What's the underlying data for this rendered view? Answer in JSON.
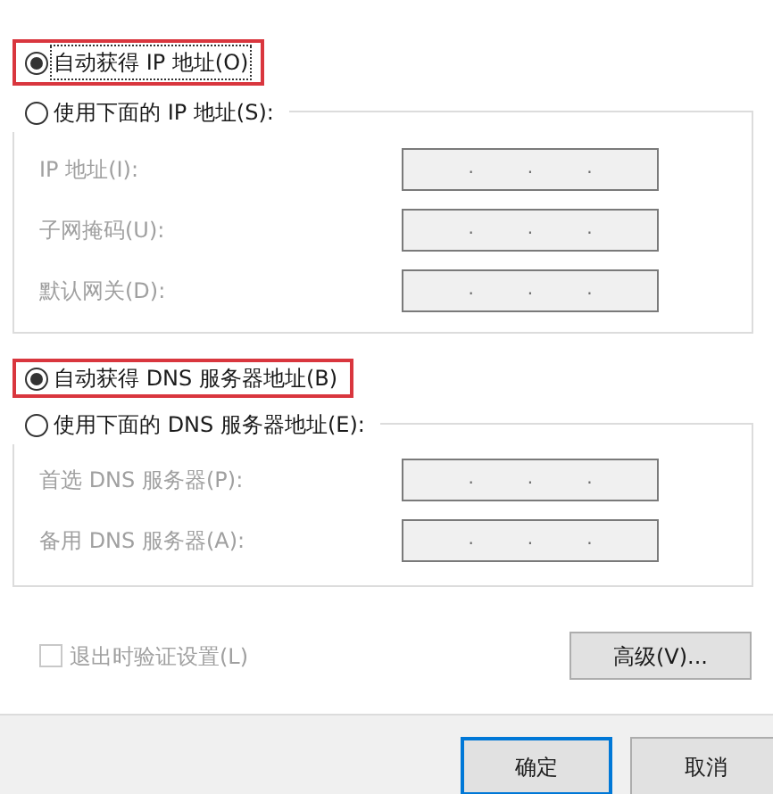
{
  "ip_section": {
    "options": [
      {
        "label": "自动获得 IP 地址(O)",
        "selected": true,
        "highlighted": true,
        "focused": true
      },
      {
        "label": "使用下面的 IP 地址(S):",
        "selected": false,
        "highlighted": false,
        "focused": false
      }
    ],
    "fields": [
      {
        "label": "IP 地址(I):",
        "disabled": true,
        "dots": [
          ".",
          ".",
          "."
        ]
      },
      {
        "label": "子网掩码(U):",
        "disabled": true,
        "dots": [
          ".",
          ".",
          "."
        ]
      },
      {
        "label": "默认网关(D):",
        "disabled": true,
        "dots": [
          ".",
          ".",
          "."
        ]
      }
    ]
  },
  "dns_section": {
    "options": [
      {
        "label": "自动获得 DNS 服务器地址(B)",
        "selected": true,
        "highlighted": true,
        "focused": false
      },
      {
        "label": "使用下面的 DNS 服务器地址(E):",
        "selected": false,
        "highlighted": false,
        "focused": false
      }
    ],
    "fields": [
      {
        "label": "首选 DNS 服务器(P):",
        "disabled": true,
        "dots": [
          ".",
          ".",
          "."
        ]
      },
      {
        "label": "备用 DNS 服务器(A):",
        "disabled": true,
        "dots": [
          ".",
          ".",
          "."
        ]
      }
    ]
  },
  "validate_checkbox": {
    "label": "退出时验证设置(L)",
    "checked": false,
    "disabled": true
  },
  "advanced_button": {
    "label": "高级(V)..."
  },
  "footer_buttons": [
    {
      "label": "确定",
      "default": true
    },
    {
      "label": "取消",
      "default": false
    }
  ]
}
